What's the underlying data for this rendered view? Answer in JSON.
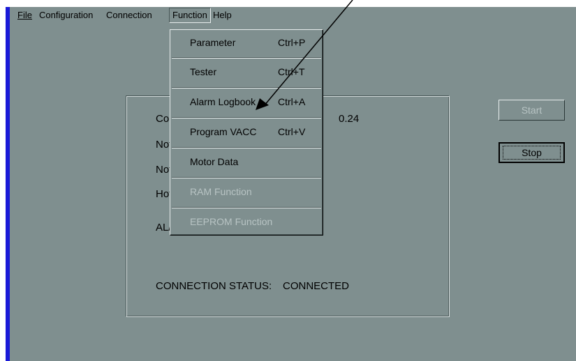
{
  "menubar": {
    "items": [
      {
        "label": "File"
      },
      {
        "label": "Configuration"
      },
      {
        "label": "Connection"
      },
      {
        "label": "Function"
      },
      {
        "label": "Help"
      }
    ]
  },
  "function_menu": {
    "items": [
      {
        "label": "Parameter",
        "shortcut": "Ctrl+P",
        "enabled": true
      },
      {
        "label": "Tester",
        "shortcut": "Ctrl+T",
        "enabled": true
      },
      {
        "label": "Alarm Logbook",
        "shortcut": "Ctrl+A",
        "enabled": true
      },
      {
        "label": "Program VACC",
        "shortcut": "Ctrl+V",
        "enabled": true
      },
      {
        "label": "Motor Data",
        "shortcut": "",
        "enabled": true
      },
      {
        "label": "RAM Function",
        "shortcut": "",
        "enabled": false
      },
      {
        "label": "EEPROM Function",
        "shortcut": "",
        "enabled": false
      }
    ]
  },
  "panel": {
    "rows": [
      {
        "text": "Cor"
      },
      {
        "text": "Not"
      },
      {
        "text": "Not"
      },
      {
        "text": "Hot"
      },
      {
        "text": "AL/"
      }
    ],
    "value_fragment": "0.24",
    "status_label": "CONNECTION STATUS:",
    "status_value": "CONNECTED"
  },
  "buttons": {
    "start": "Start",
    "stop": "Stop"
  },
  "colors": {
    "window_bg": "#7f8f8f",
    "left_border": "#1a1ad8",
    "disabled_text": "#b8c4c4"
  }
}
